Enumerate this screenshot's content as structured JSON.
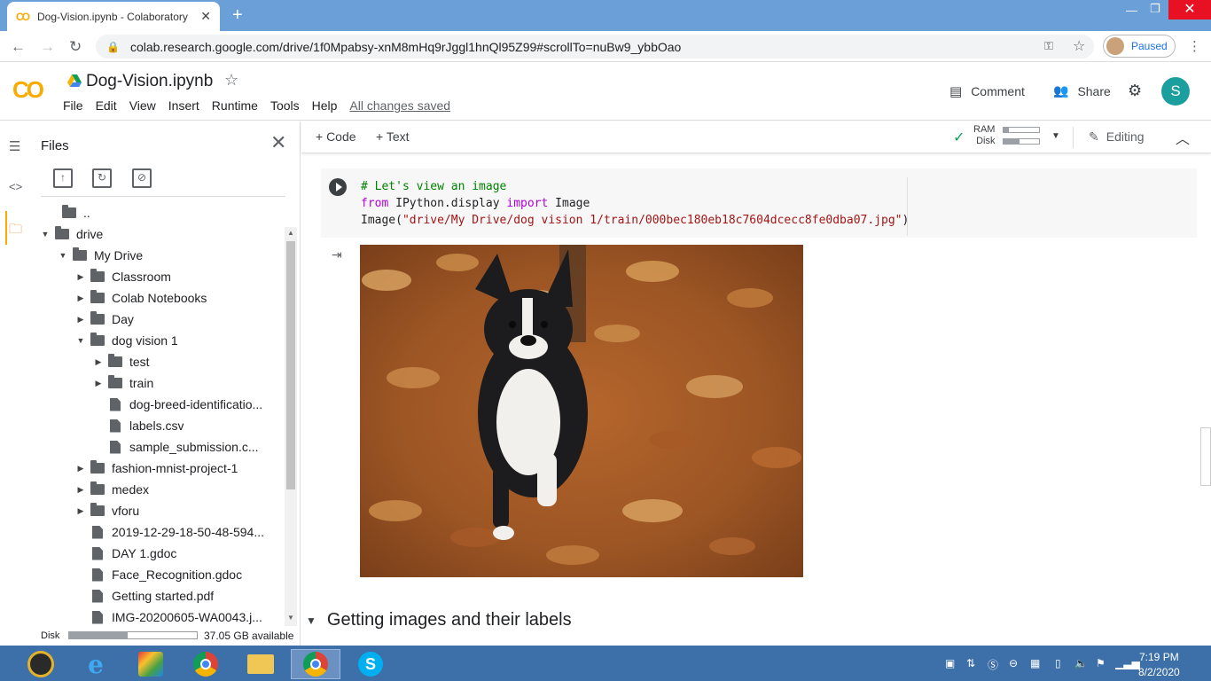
{
  "browser": {
    "tab_title": "Dog-Vision.ipynb - Colaboratory",
    "tab_icon": "CO",
    "url": "colab.research.google.com/drive/1f0Mpabsy-xnM8mHq9rJggl1hnQl95Z99#scrollTo=nuBw9_ybbOao",
    "profile_status": "Paused"
  },
  "colab": {
    "logo": "CO",
    "notebook_title": "Dog-Vision.ipynb",
    "menu": [
      "File",
      "Edit",
      "View",
      "Insert",
      "Runtime",
      "Tools",
      "Help"
    ],
    "saved_status": "All changes saved",
    "comment_label": "Comment",
    "share_label": "Share",
    "avatar_letter": "S",
    "toolbar": {
      "add_code": "+ Code",
      "add_text": "+ Text",
      "ram_label": "RAM",
      "disk_label": "Disk",
      "editing_label": "Editing"
    }
  },
  "files_panel": {
    "title": "Files",
    "tree": [
      {
        "label": "..",
        "type": "up",
        "depth": 0,
        "arrow": ""
      },
      {
        "label": "drive",
        "type": "folder",
        "depth": 0,
        "arrow": "down"
      },
      {
        "label": "My Drive",
        "type": "folder",
        "depth": 1,
        "arrow": "down"
      },
      {
        "label": "Classroom",
        "type": "folder",
        "depth": 2,
        "arrow": "right"
      },
      {
        "label": "Colab Notebooks",
        "type": "folder",
        "depth": 2,
        "arrow": "right"
      },
      {
        "label": "Day",
        "type": "folder",
        "depth": 2,
        "arrow": "right"
      },
      {
        "label": "dog vision 1",
        "type": "folder",
        "depth": 2,
        "arrow": "down"
      },
      {
        "label": "test",
        "type": "folder",
        "depth": 3,
        "arrow": "right"
      },
      {
        "label": "train",
        "type": "folder",
        "depth": 3,
        "arrow": "right"
      },
      {
        "label": "dog-breed-identificatio...",
        "type": "file",
        "depth": 3,
        "arrow": ""
      },
      {
        "label": "labels.csv",
        "type": "file",
        "depth": 3,
        "arrow": ""
      },
      {
        "label": "sample_submission.c...",
        "type": "file",
        "depth": 3,
        "arrow": ""
      },
      {
        "label": "fashion-mnist-project-1",
        "type": "folder",
        "depth": 2,
        "arrow": "right"
      },
      {
        "label": "medex",
        "type": "folder",
        "depth": 2,
        "arrow": "right"
      },
      {
        "label": "vforu",
        "type": "folder",
        "depth": 2,
        "arrow": "right"
      },
      {
        "label": "2019-12-29-18-50-48-594...",
        "type": "file",
        "depth": 2,
        "arrow": ""
      },
      {
        "label": "DAY 1.gdoc",
        "type": "file",
        "depth": 2,
        "arrow": ""
      },
      {
        "label": "Face_Recognition.gdoc",
        "type": "file",
        "depth": 2,
        "arrow": ""
      },
      {
        "label": "Getting started.pdf",
        "type": "file",
        "depth": 2,
        "arrow": ""
      },
      {
        "label": "IMG-20200605-WA0043.j...",
        "type": "file",
        "depth": 2,
        "arrow": ""
      }
    ],
    "disk_label": "Disk",
    "disk_used_fraction": 0.46,
    "disk_available": "37.05 GB available"
  },
  "code_cell": {
    "line1_comment": "# Let's view an image",
    "line2_from": "from",
    "line2_mod": " IPython.display ",
    "line2_import": "import",
    "line2_name": " Image",
    "line3_call": "Image(",
    "line3_str": "\"drive/My Drive/dog vision 1/train/000bec180eb18c7604dcecc8fe0dba07.jpg\"",
    "line3_close": ")"
  },
  "section_heading": "Getting images and their labels",
  "taskbar": {
    "time": "7:19 PM",
    "date": "8/2/2020"
  },
  "colors": {
    "colab_orange": "#f9ab00",
    "tab_strip": "#6a9fd8",
    "taskbar": "#3d6fa8",
    "avatar": "#1a9e9e"
  }
}
